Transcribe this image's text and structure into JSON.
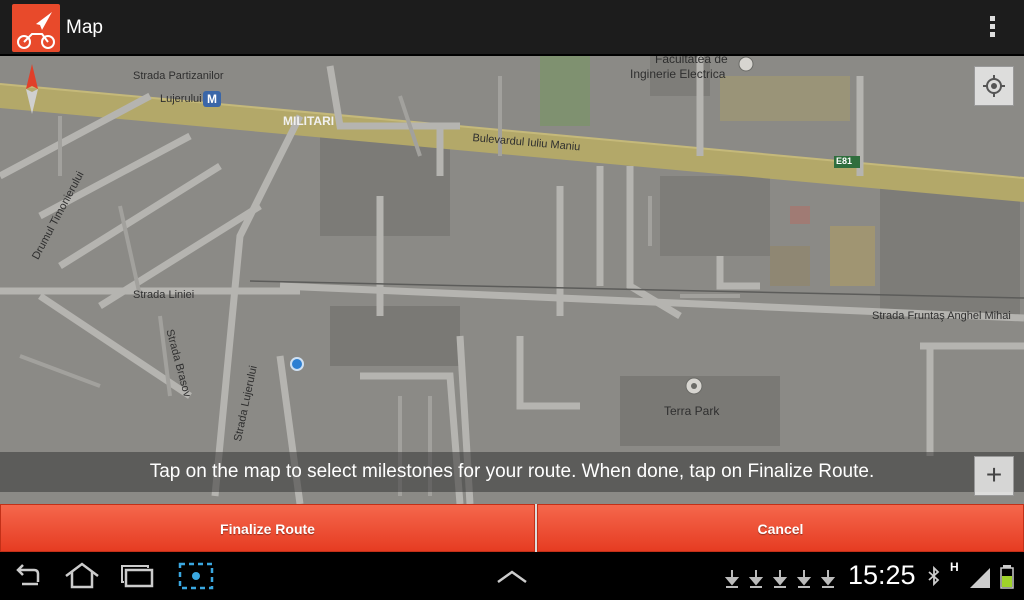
{
  "app": {
    "title": "Map",
    "icon": "bicycle-navigation-icon",
    "brand_color": "#e84a2b"
  },
  "actionbar": {
    "overflow_icon": "overflow-menu-icon"
  },
  "map": {
    "labels": {
      "strada_partizanilor": "Strada Partizanilor",
      "lujerului": "Lujerului",
      "metro": "M",
      "militari": "MILITARI",
      "bulevardul": "Bulevardul Iuliu Maniu",
      "facultatea": "Facultatea de",
      "inginerie": "Inginerie Electrica",
      "e81": "E81",
      "drumul": "Drumul Timonierului",
      "strada_liniei": "Strada Liniei",
      "strada_brasov": "Strada Brasov",
      "strada_lujerului": "Strada Lujerului",
      "strada_fruntas": "Strada Fruntaş Anghel Mihai",
      "terra_park": "Terra Park"
    },
    "zoom_in_label": "+",
    "instruction": "Tap on the map to select milestones for your route. When done, tap on Finalize Route."
  },
  "buttons": {
    "finalize": "Finalize Route",
    "cancel": "Cancel"
  },
  "statusbar": {
    "time": "15:25",
    "network": "H",
    "icons": [
      "back-icon",
      "home-icon",
      "recent-apps-icon",
      "screenshot-icon",
      "up-arrow-icon",
      "download-icon",
      "bluetooth-icon",
      "signal-icon",
      "battery-icon"
    ],
    "accent": "#e63c22"
  }
}
